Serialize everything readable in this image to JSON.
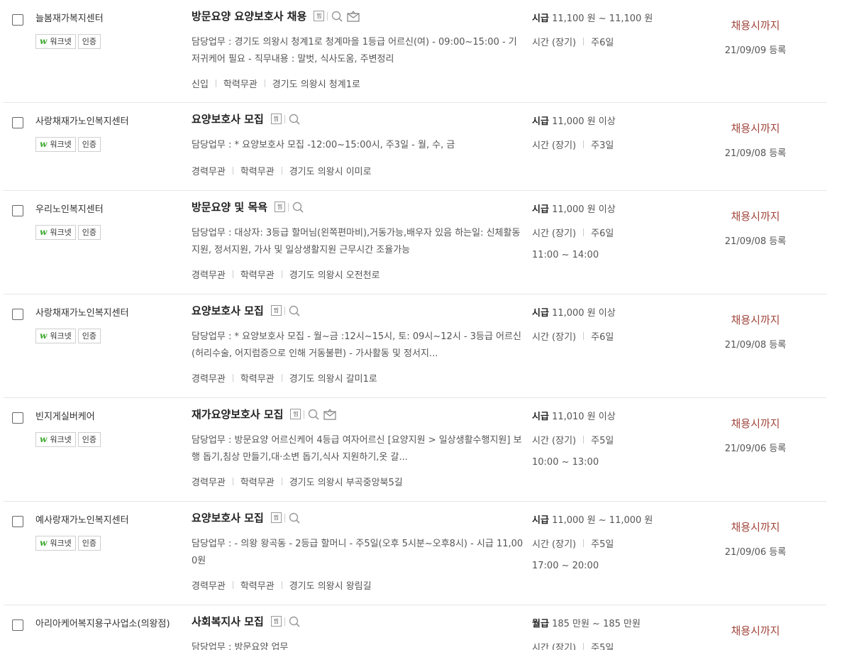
{
  "rows": [
    {
      "company": "늘봄재가복지센터",
      "badge_worknet": "워크넷",
      "badge_cert": "인증",
      "title": "방문요양 요양보호사 채용",
      "scrap_label": "찜",
      "has_mail": true,
      "duty": "담당업무 : 경기도 의왕시 청계1로 청계마을 1등급 어르신(여) - 09:00~15:00 - 기저귀케어 필요 - 직무내용 : 말벗, 식사도움, 주변정리",
      "tags": [
        "신입",
        "학력무관",
        "경기도 의왕시 청계1로"
      ],
      "pay_type": "시급",
      "pay_amount": "11,100 원 ~ 11,100 원",
      "work_term": "시간 (장기)",
      "work_days": "주6일",
      "hours": "",
      "deadline": "채용시까지",
      "registered": "21/09/09 등록"
    },
    {
      "company": "사랑채재가노인복지센터",
      "badge_worknet": "워크넷",
      "badge_cert": "인증",
      "title": "요양보호사 모집",
      "scrap_label": "찜",
      "has_mail": false,
      "duty": "담당업무 : * 요양보호사 모집 -12:00~15:00시, 주3일 - 월, 수, 금",
      "tags": [
        "경력무관",
        "학력무관",
        "경기도 의왕시 이미로"
      ],
      "pay_type": "시급",
      "pay_amount": "11,000 원 이상",
      "work_term": "시간 (장기)",
      "work_days": "주3일",
      "hours": "",
      "deadline": "채용시까지",
      "registered": "21/09/08 등록"
    },
    {
      "company": "우리노인복지센터",
      "badge_worknet": "워크넷",
      "badge_cert": "인증",
      "title": "방문요양 및 목욕",
      "scrap_label": "찜",
      "has_mail": false,
      "duty": "담당업무 : 대상자: 3등급 할머님(왼쪽편마비),거동가능,배우자 있음 하는일: 신체활동지원, 정서지원, 가사 및 일상생활지원 근무시간 조율가능",
      "tags": [
        "경력무관",
        "학력무관",
        "경기도 의왕시 오전천로"
      ],
      "pay_type": "시급",
      "pay_amount": "11,000 원 이상",
      "work_term": "시간 (장기)",
      "work_days": "주6일",
      "hours": "11:00 ~ 14:00",
      "deadline": "채용시까지",
      "registered": "21/09/08 등록"
    },
    {
      "company": "사랑채재가노인복지센터",
      "badge_worknet": "워크넷",
      "badge_cert": "인증",
      "title": "요양보호사 모집",
      "scrap_label": "찜",
      "has_mail": false,
      "duty": "담당업무 : * 요양보호사 모집 - 월~금 :12시~15시, 토: 09시~12시 - 3등급 어르신(허리수술, 어지럼증으로 인해 거동불편) - 가사활동 및 정서지...",
      "tags": [
        "경력무관",
        "학력무관",
        "경기도 의왕시 갈미1로"
      ],
      "pay_type": "시급",
      "pay_amount": "11,000 원 이상",
      "work_term": "시간 (장기)",
      "work_days": "주6일",
      "hours": "",
      "deadline": "채용시까지",
      "registered": "21/09/08 등록"
    },
    {
      "company": "빈지게실버케어",
      "badge_worknet": "워크넷",
      "badge_cert": "인증",
      "title": "재가요양보호사 모집",
      "scrap_label": "찜",
      "has_mail": true,
      "duty": "담당업무 : 방문요양 어르신케어 4등급 여자어르신 [요양지원 > 일상생활수행지원] 보행 돕기,침상 만들기,대·소변 돕기,식사 지원하기,옷 갈...",
      "tags": [
        "경력무관",
        "학력무관",
        "경기도 의왕시 부곡중앙북5길"
      ],
      "pay_type": "시급",
      "pay_amount": "11,010 원 이상",
      "work_term": "시간 (장기)",
      "work_days": "주5일",
      "hours": "10:00 ~ 13:00",
      "deadline": "채용시까지",
      "registered": "21/09/06 등록"
    },
    {
      "company": "예사랑재가노인복지센터",
      "badge_worknet": "워크넷",
      "badge_cert": "인증",
      "title": "요양보호사 모집",
      "scrap_label": "찜",
      "has_mail": false,
      "duty": "담당업무 : - 의왕 왕곡동 - 2등급 할머니 - 주5일(오후 5시분~오후8시) - 시급 11,000원",
      "tags": [
        "경력무관",
        "학력무관",
        "경기도 의왕시 왕림길"
      ],
      "pay_type": "시급",
      "pay_amount": "11,000 원 ~ 11,000 원",
      "work_term": "시간 (장기)",
      "work_days": "주5일",
      "hours": "17:00 ~ 20:00",
      "deadline": "채용시까지",
      "registered": "21/09/06 등록"
    },
    {
      "company": "아리아케어복지용구사업소(의왕점)",
      "badge_worknet": "",
      "badge_cert": "",
      "title": "사회복지사 모집",
      "scrap_label": "찜",
      "has_mail": false,
      "duty": "담당업무 : 방문요양 업무",
      "tags": [],
      "pay_type": "월급",
      "pay_amount": "185 만원 ~ 185 만원",
      "work_term": "시간 (장기)",
      "work_days": "주5일",
      "hours": "",
      "deadline": "채용시까지",
      "registered": ""
    }
  ]
}
